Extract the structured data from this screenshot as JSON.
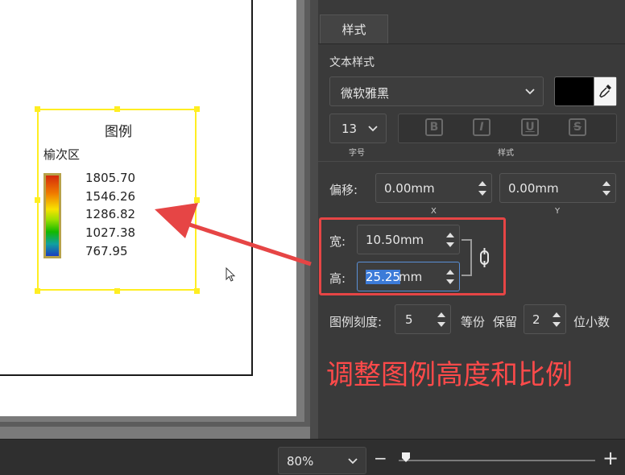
{
  "canvas": {
    "legend": {
      "title": "图例",
      "subtitle": "榆次区",
      "values": [
        "1805.70",
        "1546.26",
        "1286.82",
        "1027.38",
        "767.95"
      ]
    }
  },
  "panel": {
    "tab_label": "样式",
    "text_style_label": "文本样式",
    "font_family": "微软雅黑",
    "font_color": "#000000",
    "font_size": "13",
    "font_size_caption": "字号",
    "style_caption": "样式",
    "style_buttons": [
      "B",
      "I",
      "U",
      "S"
    ],
    "offset_label": "偏移:",
    "offset_x": "0.00mm",
    "offset_y": "0.00mm",
    "x_caption": "X",
    "y_caption": "Y",
    "width_label": "宽:",
    "width_value": "10.50mm",
    "height_label": "高:",
    "height_value_selected": "25.25",
    "height_value_unit": "mm",
    "scale_label": "图例刻度:",
    "scale_value": "5",
    "equal_parts_label": "等份",
    "retain_label": "保留",
    "decimals_value": "2",
    "decimals_label": "位小数"
  },
  "annotation": {
    "text": "调整图例高度和比例",
    "color": "#ff4a4a"
  },
  "bottombar": {
    "zoom": "80%",
    "zoom_out": "−",
    "zoom_in": "+",
    "zoom_slider_fraction": 0.0
  }
}
